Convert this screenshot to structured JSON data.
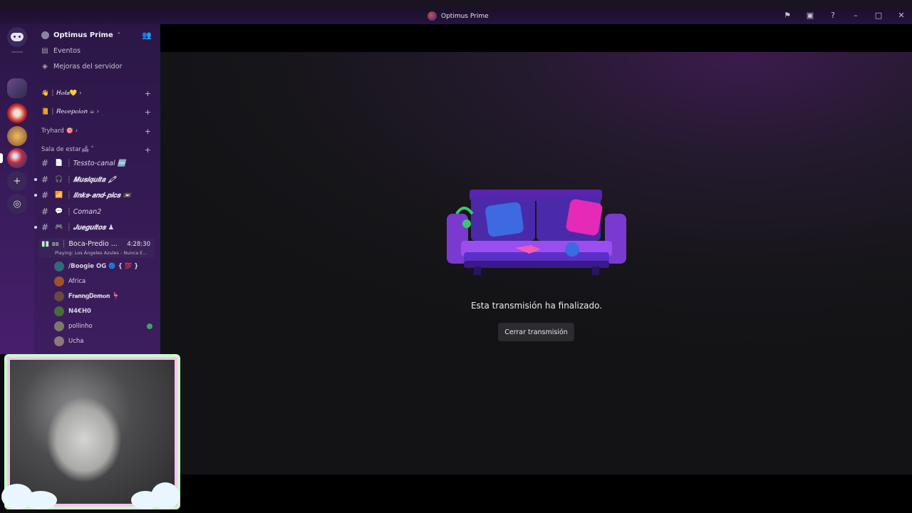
{
  "window": {
    "title": "Optimus Prime",
    "icons": [
      "flag-icon",
      "inbox-icon",
      "help-icon",
      "minimize-icon",
      "maximize-icon",
      "close-icon"
    ]
  },
  "rail": {
    "items": [
      "home-icon",
      "server-1",
      "server-2",
      "server-3",
      "server-optimus-prime",
      "add-server-icon",
      "explore-icon"
    ]
  },
  "server": {
    "name": "Optimus Prime",
    "chevron": "˅"
  },
  "menu": {
    "events": "Eventos",
    "boosts": "Mejoras del servidor"
  },
  "categories": [
    {
      "label": "𝑯𝒐𝒍𝒂💛",
      "prefix": "👋 ┊"
    },
    {
      "label": "𝑹𝒆𝒄𝒆𝒑𝒄𝒊𝒐𝒏 ☕",
      "prefix": "📙 ┊"
    },
    {
      "label": "Tryhard 🎯",
      "prefix": ""
    },
    {
      "label": "Sala de estar🛋",
      "prefix": ""
    }
  ],
  "channels": [
    {
      "emoji": "📄",
      "name": "Tessto-canal 🆒"
    },
    {
      "emoji": "🎧",
      "name": "𝑴𝒖𝒔𝒊𝒒𝒖𝒊𝒕𝒂 🖍"
    },
    {
      "emoji": "📶",
      "name": "𝒍𝒊𝒏𝒌𝒔-𝒂𝒏𝒅-𝒑𝒊𝒄𝒔 📼"
    },
    {
      "emoji": "💬",
      "name": "Coman2"
    },
    {
      "emoji": "🎮",
      "name": "𝑱𝒖𝒆𝒈𝒖𝒊𝒕𝒐𝒔 ♟"
    }
  ],
  "voice": {
    "badge": "BB",
    "name": "Boca-Predio ...",
    "timer": "4:28:30",
    "activity": "Playing: Los Ángeles Azules - Nunca E..."
  },
  "users": [
    {
      "name": "/Boogie OG 🔵 { 💯 }",
      "color": "#2f6b7a"
    },
    {
      "name": "Africa",
      "color": "#a0522d"
    },
    {
      "name": "𝐅𝐫𝐚𝐧𝐧𝐠𝐃𝐞𝐦𝐨𝐧 🦩",
      "color": "#6a4a3a"
    },
    {
      "name": "N4€H0",
      "color": "#4a6a3a"
    },
    {
      "name": "pollinho",
      "color": "#7a7a6a"
    },
    {
      "name": "Ucha",
      "color": "#8a7a7a"
    }
  ],
  "stream": {
    "message": "Esta transmisión ha finalizado.",
    "close_label": "Cerrar transmisión"
  }
}
